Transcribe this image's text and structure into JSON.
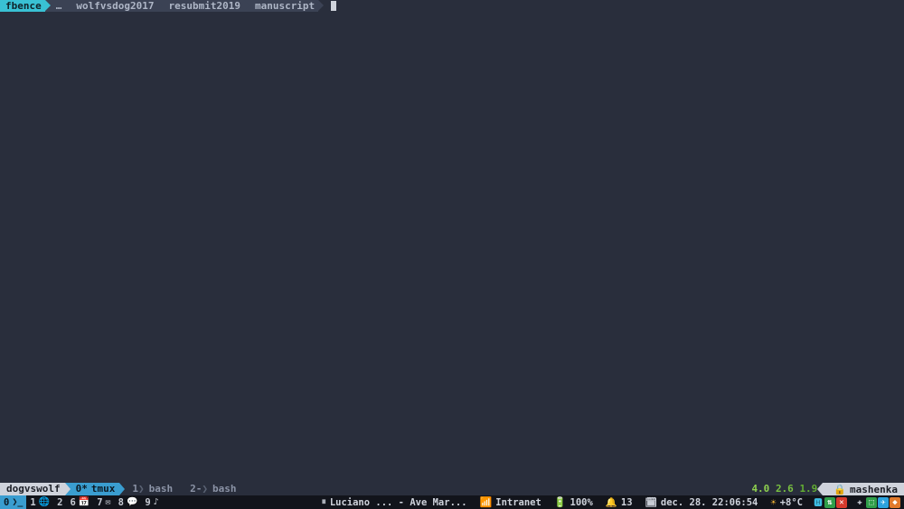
{
  "prompt": {
    "user": "fbence",
    "segments": [
      "…",
      "wolfvsdog2017",
      "resubmit2019",
      "manuscript"
    ]
  },
  "tmux": {
    "session": "dogvswolf",
    "current_window": {
      "index": "0*",
      "name": "tmux"
    },
    "other_windows": [
      {
        "index": "1",
        "name": "bash"
      },
      {
        "index": "2-",
        "name": "bash"
      }
    ],
    "load": [
      "4.0",
      "2.6",
      "1.9"
    ],
    "host": "mashenka"
  },
  "taskbar": {
    "workspaces": [
      {
        "num": "0",
        "icon": "terminal-icon",
        "active": true
      },
      {
        "num": "1",
        "icon": "browser-icon",
        "active": false
      },
      {
        "num": "2",
        "icon": "",
        "active": false
      },
      {
        "num": "6",
        "icon": "calendar-icon",
        "active": false
      },
      {
        "num": "7",
        "icon": "mail-icon",
        "active": false
      },
      {
        "num": "8",
        "icon": "chat-icon",
        "active": false
      },
      {
        "num": "9",
        "icon": "music-icon",
        "active": false
      }
    ],
    "music": "Luciano ... - Ave Mar...",
    "wifi": "Intranet",
    "battery": "100%",
    "notifications": "13",
    "datetime": "dec. 28. 22:06:54",
    "weather": "+8°C"
  }
}
